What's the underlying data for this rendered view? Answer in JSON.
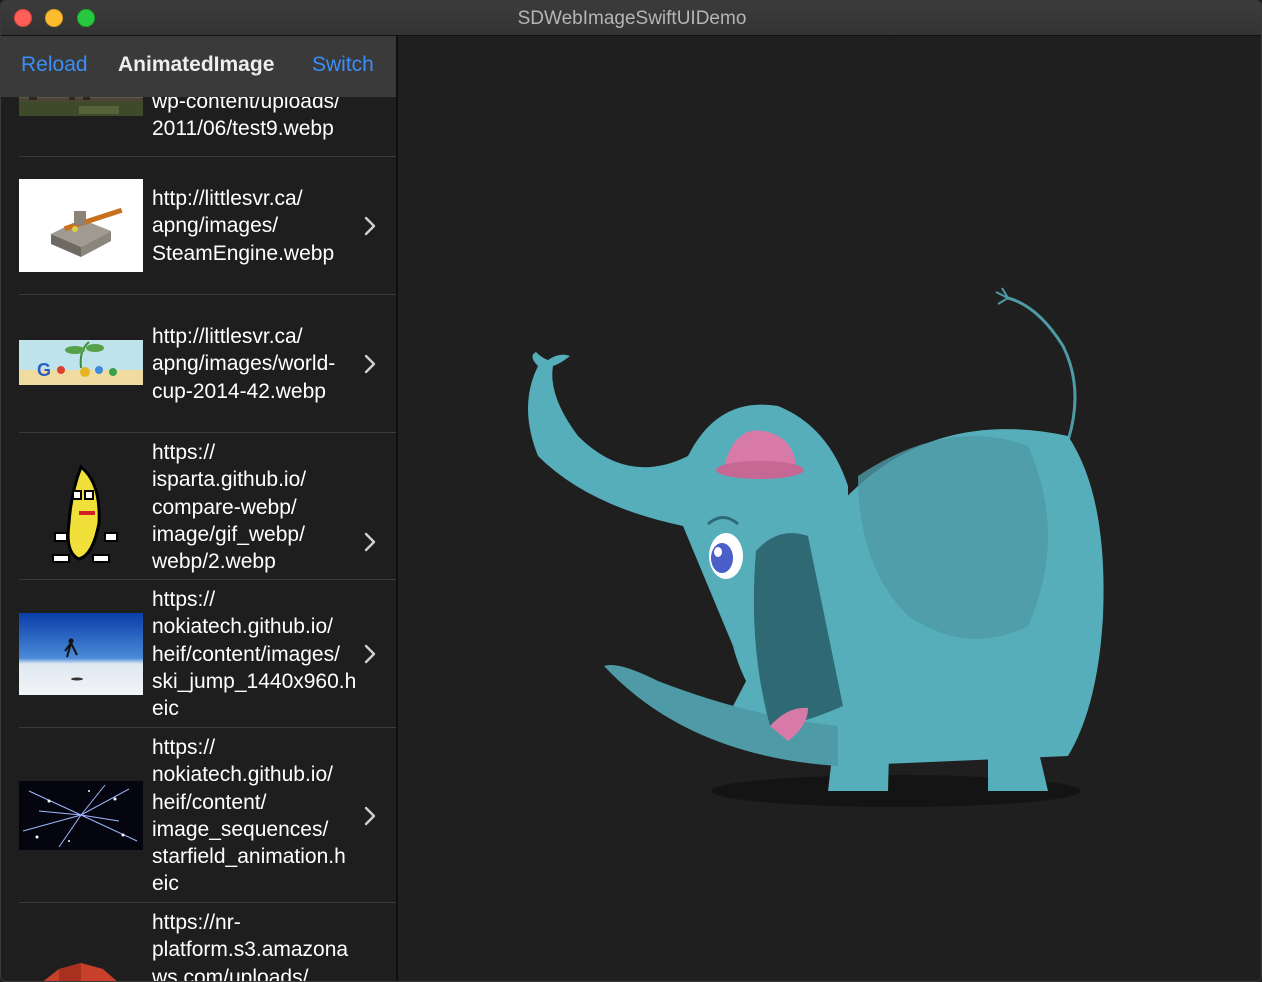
{
  "window": {
    "title": "SDWebImageSwiftUIDemo"
  },
  "navbar": {
    "reload_label": "Reload",
    "title": "AnimatedImage",
    "switch_label": "Switch"
  },
  "list": {
    "items": [
      {
        "url": "wp-content/uploads/\n2011/06/test9.webp",
        "thumb": "landscape"
      },
      {
        "url": "http://littlesvr.ca/\napng/images/\nSteamEngine.webp",
        "thumb": "steam-engine"
      },
      {
        "url": "http://littlesvr.ca/\napng/images/world-\ncup-2014-42.webp",
        "thumb": "google-doodle"
      },
      {
        "url": "https://\nisparta.github.io/\ncompare-webp/\nimage/gif_webp/\nwebp/2.webp",
        "thumb": "dancing-banana"
      },
      {
        "url": "https://\nnokiatech.github.io/\nheif/content/images/\nski_jump_1440x960.h\neic",
        "thumb": "ski-jump"
      },
      {
        "url": "https://\nnokiatech.github.io/\nheif/content/\nimage_sequences/\nstarfield_animation.h\neic",
        "thumb": "starfield"
      },
      {
        "url": "https://nr-\nplatform.s3.amazona\nws.com/uploads/",
        "thumb": "red-shape"
      }
    ]
  },
  "detail": {
    "image": "elephant-animation"
  },
  "colors": {
    "accent": "#3a8ef6",
    "elephant": "#56aebb",
    "hat": "#d77aa8"
  }
}
